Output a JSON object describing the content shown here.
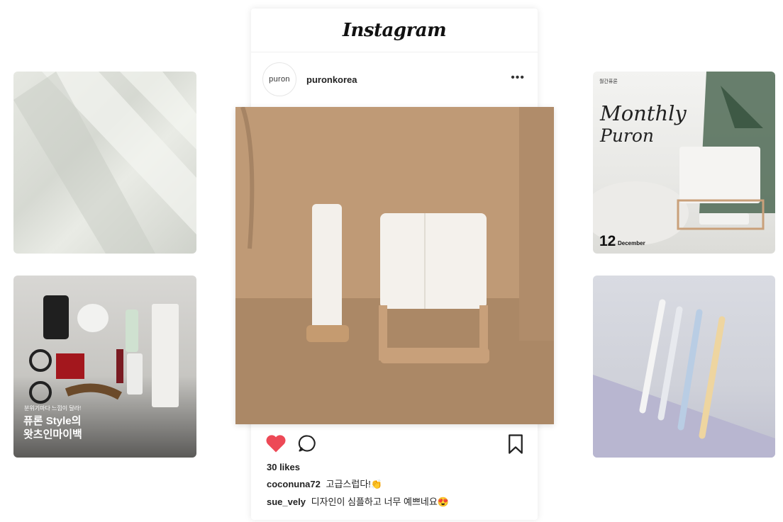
{
  "app": {
    "title": "Instagram"
  },
  "post": {
    "avatar_text": "puron",
    "username": "puronkorea",
    "likes": "30 likes",
    "comments": [
      {
        "user": "coconuna72",
        "text": "고급스럽다!👏"
      },
      {
        "user": "sue_vely",
        "text": "디자인이 심플하고 너무 예쁘네요😍"
      }
    ]
  },
  "tiles": {
    "monthly": {
      "tag": "월간퓨론",
      "title_line1": "Monthly",
      "title_line2": "Puron",
      "day": "12",
      "month": "December"
    },
    "flatlay": {
      "subtitle": "분위기마다 느낌이 달라!",
      "title_line1": "퓨론 Style의",
      "title_line2": "왓츠인마이백"
    }
  },
  "icons": {
    "heart": "heart-icon",
    "comment": "comment-icon",
    "bookmark": "bookmark-icon",
    "more": "more-options-icon"
  },
  "colors": {
    "heart": "#ed4956",
    "brand_gold": "#c8a27a"
  }
}
